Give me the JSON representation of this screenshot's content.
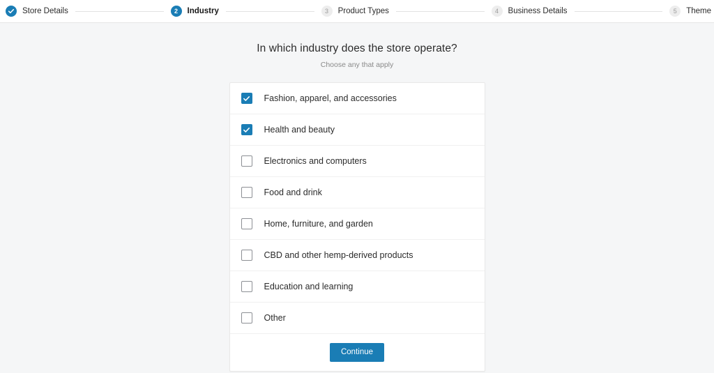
{
  "stepper": {
    "steps": [
      {
        "number": "1",
        "label": "Store Details",
        "state": "done",
        "icon": "check-icon"
      },
      {
        "number": "2",
        "label": "Industry",
        "state": "current"
      },
      {
        "number": "3",
        "label": "Product Types",
        "state": "upcoming"
      },
      {
        "number": "4",
        "label": "Business Details",
        "state": "upcoming"
      },
      {
        "number": "5",
        "label": "Theme",
        "state": "upcoming"
      }
    ]
  },
  "main": {
    "heading": "In which industry does the store operate?",
    "subheading": "Choose any that apply",
    "options": [
      {
        "label": "Fashion, apparel, and accessories",
        "checked": true
      },
      {
        "label": "Health and beauty",
        "checked": true
      },
      {
        "label": "Electronics and computers",
        "checked": false
      },
      {
        "label": "Food and drink",
        "checked": false
      },
      {
        "label": "Home, furniture, and garden",
        "checked": false
      },
      {
        "label": "CBD and other hemp-derived products",
        "checked": false
      },
      {
        "label": "Education and learning",
        "checked": false
      },
      {
        "label": "Other",
        "checked": false
      }
    ],
    "continue_label": "Continue"
  },
  "colors": {
    "accent": "#1a7db5",
    "page_background": "#f5f6f7",
    "card_background": "#ffffff",
    "text": "#2b2b2b",
    "muted_text": "#8a8a8a"
  }
}
